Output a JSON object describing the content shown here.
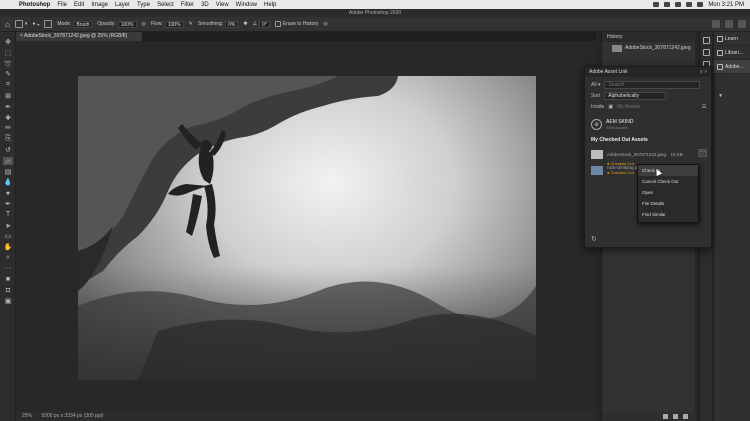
{
  "menubar": {
    "app": "Photoshop",
    "items": [
      "File",
      "Edit",
      "Image",
      "Layer",
      "Type",
      "Select",
      "Filter",
      "3D",
      "View",
      "Window",
      "Help"
    ],
    "time": "Mon 3:21 PM"
  },
  "window_title": "Adobe Photoshop 2020",
  "options": {
    "mode_label": "Mode:",
    "mode_value": "Brush",
    "opacity_label": "Opacity:",
    "opacity_value": "100%",
    "flow_label": "Flow:",
    "flow_value": "100%",
    "smoothing_label": "Smoothing:",
    "smoothing_value": "0%",
    "angle_value": "0°",
    "erase_history": "Erase to History"
  },
  "document_tab": "AdobeStock_307871242.jpeg @ 25% (RGB/8)",
  "status": {
    "zoom": "25%",
    "info": "5000 px x 3334 px (300 ppi)"
  },
  "history_panel": {
    "title": "History",
    "item": "AdobeStock_307871242.jpeg"
  },
  "libraries": {
    "items": [
      "Learn",
      "Librari...",
      "Adobe..."
    ]
  },
  "asset_link": {
    "title": "Adobe Asset Link",
    "sort_label": "Sort",
    "sort_value": "Alphabetically",
    "search_placeholder": "Search",
    "inside_label": "Inside",
    "inside_value": "My Assets",
    "server_name": "AEM SKIND",
    "server_sub": "AEM Assets",
    "section_title": "My Checked Out Assets",
    "assets": [
      {
        "name": "AdobeStock_307871242.jpeg",
        "size": "10 KB",
        "status": "Checked Out"
      },
      {
        "name": "rock-climbing.png",
        "size": "",
        "status": "Checked Out"
      }
    ]
  },
  "context_menu": {
    "items": [
      "Check In",
      "Cancel Check Out",
      "Open",
      "File Details",
      "Find Similar"
    ]
  },
  "tools": [
    "move",
    "marquee",
    "lasso",
    "quick-select",
    "crop",
    "frame",
    "eyedropper",
    "heal",
    "brush",
    "stamp",
    "history-brush",
    "eraser",
    "gradient",
    "blur",
    "dodge",
    "pen",
    "type",
    "path-select",
    "rectangle",
    "hand",
    "zoom",
    "more",
    "colors",
    "mask",
    "screen-mode"
  ]
}
